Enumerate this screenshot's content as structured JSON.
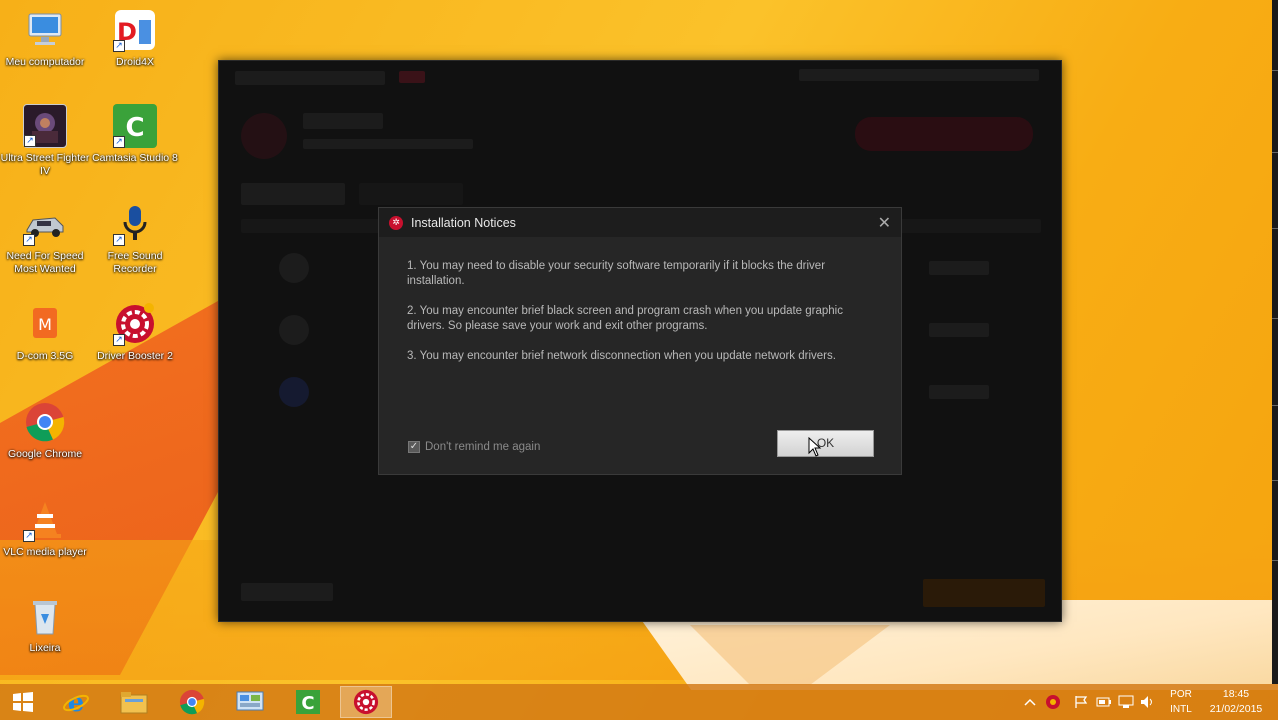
{
  "desktop": {
    "icons": [
      {
        "label": "Meu computador"
      },
      {
        "label": "Droid4X"
      },
      {
        "label": "Ultra Street Fighter IV"
      },
      {
        "label": "Camtasia Studio 8"
      },
      {
        "label": "Need For Speed Most Wanted"
      },
      {
        "label": "Free Sound Recorder"
      },
      {
        "label": "D-com 3.5G"
      },
      {
        "label": "Driver Booster 2"
      },
      {
        "label": "Google Chrome"
      },
      {
        "label": "VLC media player"
      },
      {
        "label": "Lixeira"
      }
    ]
  },
  "dialog": {
    "title": "Installation Notices",
    "close_glyph": "✕",
    "notices": [
      "1. You may need to disable your security software temporarily if it blocks the driver installation.",
      "2. You may encounter brief black screen and program crash when you update graphic drivers. So please save your work and exit other programs.",
      "3. You may encounter brief network disconnection when you update network drivers."
    ],
    "remind_label": "Don't remind me again",
    "remind_checked": true,
    "ok_label": "OK"
  },
  "taskbar": {
    "apps": [
      {
        "icon": "start-icon"
      },
      {
        "icon": "internet-explorer-icon"
      },
      {
        "icon": "file-explorer-icon"
      },
      {
        "icon": "chrome-icon"
      },
      {
        "icon": "control-panel-icon"
      },
      {
        "icon": "camtasia-icon"
      },
      {
        "icon": "driver-booster-icon"
      }
    ],
    "language": "POR",
    "layout": "INTL",
    "time": "18:45",
    "date": "21/02/2015"
  },
  "colors": {
    "accent": "#c8102e",
    "dialog_bg": "#262626",
    "taskbar": "#d2781a"
  }
}
